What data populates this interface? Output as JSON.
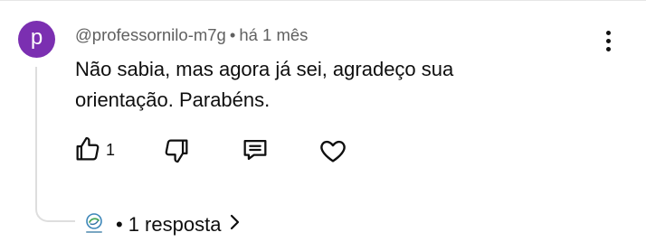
{
  "comment": {
    "avatar_letter": "p",
    "avatar_color": "#7b2fb1",
    "author": "@professornilo-m7g",
    "separator": "•",
    "time": "há 1 mês",
    "text": "Não sabia, mas agora já sei, agradeço sua orientação. Parabéns.",
    "like_count": "1"
  },
  "icons": {
    "like": "thumbs-up-icon",
    "dislike": "thumbs-down-icon",
    "reply": "comment-icon",
    "heart": "heart-icon",
    "more": "vertical-dots-icon",
    "chevron": "chevron-right-icon"
  },
  "replies": {
    "separator": "•",
    "label": "1 resposta"
  }
}
